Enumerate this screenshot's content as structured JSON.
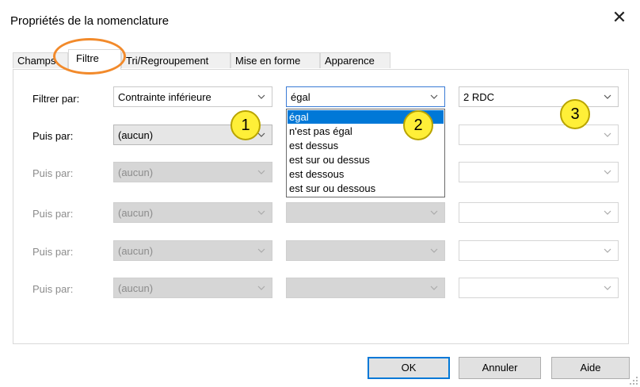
{
  "window": {
    "title": "Propriétés de la nomenclature",
    "close_glyph": "✕"
  },
  "tabs": [
    {
      "label": "Champs"
    },
    {
      "label": "Filtre"
    },
    {
      "label": "Tri/Regroupement"
    },
    {
      "label": "Mise en forme"
    },
    {
      "label": "Apparence"
    }
  ],
  "filter_rows": [
    {
      "label": "Filtrer par:",
      "field": "Contrainte inférieure",
      "operator": "égal",
      "value": "2 RDC"
    },
    {
      "label": "Puis par:",
      "field": "(aucun)",
      "operator": "",
      "value": ""
    },
    {
      "label": "Puis par:",
      "field": "(aucun)",
      "operator": "",
      "value": ""
    },
    {
      "label": "Puis par:",
      "field": "(aucun)",
      "operator": "",
      "value": ""
    },
    {
      "label": "Puis par:",
      "field": "(aucun)",
      "operator": "",
      "value": ""
    },
    {
      "label": "Puis par:",
      "field": "(aucun)",
      "operator": "",
      "value": ""
    }
  ],
  "operator_dropdown": {
    "options": [
      "égal",
      "n'est pas égal",
      "est dessus",
      "est sur ou dessus",
      "est dessous",
      "est sur ou dessous"
    ],
    "selected": "égal"
  },
  "callouts": [
    "1",
    "2",
    "3"
  ],
  "buttons": {
    "ok": "OK",
    "cancel": "Annuler",
    "help": "Aide"
  },
  "colors": {
    "selection": "#0078d7",
    "callout_fill": "#ffef38",
    "highlight_ring": "#f28a2b"
  }
}
